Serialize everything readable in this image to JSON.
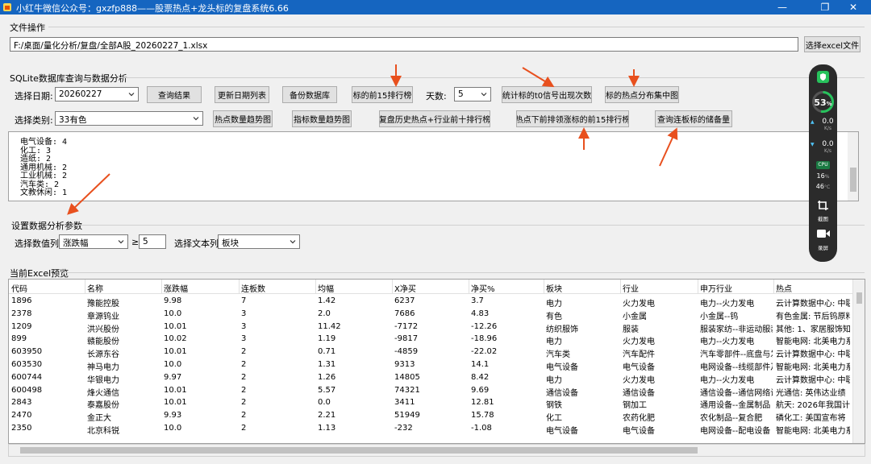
{
  "window": {
    "title": "小红牛微信公众号：gxzfp888——股票热点+龙头标的复盘系统6.66"
  },
  "file_ops": {
    "label": "文件操作",
    "path": "F:/桌面/量化分析/复盘/全部A股_20260227_1.xlsx",
    "choose_button": "选择excel文件"
  },
  "db": {
    "label": "SQLite数据库查询与数据分析",
    "date_label": "选择日期:",
    "date_value": "20260227",
    "query_button": "查询结果",
    "update_dates_button": "更新日期列表",
    "backup_button": "备份数据库",
    "top15_button": "标的前15排行榜",
    "days_label": "天数:",
    "days_value": "5",
    "t0_button": "统计标的t0信号出现次数",
    "hotspot_dist_button": "标的热点分布集中图",
    "category_label": "选择类别:",
    "category_value": "33有色",
    "hot_trend_button": "热点数量趋势图",
    "index_trend_button": "指标数量趋势图",
    "review_button": "复盘历史热点+行业前十排行榜",
    "hot_top15_button": "热点下前排领涨标的前15排行榜",
    "limitup_button": "查询连板标的储备量"
  },
  "output_lines": [
    "电气设备: 4",
    "化工: 3",
    "造纸: 2",
    "通用机械: 2",
    "工业机械: 2",
    "汽车类: 2",
    "文教休闲: 1"
  ],
  "params": {
    "label": "设置数据分析参数",
    "num_col_label": "选择数值列:",
    "num_col_value": "涨跌幅",
    "gte": "≥",
    "threshold": "5",
    "text_col_label": "选择文本列:",
    "text_col_value": "板块"
  },
  "preview": {
    "label": "当前Excel预览",
    "columns": [
      "代码",
      "名称",
      "涨跌幅",
      "连板数",
      "均幅",
      "X净买",
      "净买%",
      "板块",
      "行业",
      "申万行业",
      "热点"
    ],
    "rows": [
      [
        "1896",
        "豫能控股",
        "9.98",
        "7",
        "1.42",
        "6237",
        "3.7",
        "电力",
        "火力发电",
        "电力--火力发电",
        "云计算数据中心: 中联"
      ],
      [
        "2378",
        "章源钨业",
        "10.0",
        "3",
        "2.0",
        "7686",
        "4.83",
        "有色",
        "小金属",
        "小金属--钨",
        "有色金属: 节后钨原料"
      ],
      [
        "1209",
        "洪兴股份",
        "10.01",
        "3",
        "11.42",
        "-7172",
        "-12.26",
        "纺织服饰",
        "服装",
        "服装家纺--非运动服装",
        "其他: 1、家居服饰知名"
      ],
      [
        "899",
        "赣能股份",
        "10.02",
        "3",
        "1.19",
        "-9817",
        "-18.96",
        "电力",
        "火力发电",
        "电力--火力发电",
        "智能电网: 北美电力系统"
      ],
      [
        "603950",
        "长源东谷",
        "10.01",
        "2",
        "0.71",
        "-4859",
        "-22.02",
        "汽车类",
        "汽车配件",
        "汽车零部件--底盘与发动机",
        "云计算数据中心: 中联"
      ],
      [
        "603530",
        "神马电力",
        "10.0",
        "2",
        "1.31",
        "9313",
        "14.1",
        "电气设备",
        "电气设备",
        "电网设备--线缆部件及其他",
        "智能电网: 北美电力系统"
      ],
      [
        "600744",
        "华银电力",
        "9.97",
        "2",
        "1.26",
        "14805",
        "8.42",
        "电力",
        "火力发电",
        "电力--火力发电",
        "云计算数据中心: 中联"
      ],
      [
        "600498",
        "烽火通信",
        "10.01",
        "2",
        "5.57",
        "74321",
        "9.69",
        "通信设备",
        "通信设备",
        "通信设备--通信网络设备",
        "光通信: 英伟达业绩"
      ],
      [
        "2843",
        "泰嘉股份",
        "10.01",
        "2",
        "0.0",
        "3411",
        "12.81",
        "钢铁",
        "钢加工",
        "通用设备--金属制品",
        "航天: 2026年我国计划"
      ],
      [
        "2470",
        "金正大",
        "9.93",
        "2",
        "2.21",
        "51949",
        "15.78",
        "化工",
        "农药化肥",
        "农化制品--复合肥",
        "磷化工: 美国宣布将"
      ],
      [
        "2350",
        "北京科锐",
        "10.0",
        "2",
        "1.13",
        "-232",
        "-1.08",
        "电气设备",
        "电气设备",
        "电网设备--配电设备",
        "智能电网: 北美电力系统"
      ]
    ]
  },
  "widget": {
    "percent": "53",
    "percent_unit": "%",
    "up": "0.0",
    "up_unit": "K/s",
    "down": "0.0",
    "down_unit": "K/s",
    "cpu_label": "CPU",
    "cpu_percent": "16",
    "cpu_percent_unit": "%",
    "cpu_temp": "46",
    "cpu_temp_unit": "°C",
    "screenshot_label": "截图",
    "record_label": "录屏"
  },
  "colors": {
    "titlebar": "#1565c0",
    "arrow": "#e8501e",
    "widget_bg": "#2b2b2b",
    "widget_accent": "#27c25c"
  }
}
